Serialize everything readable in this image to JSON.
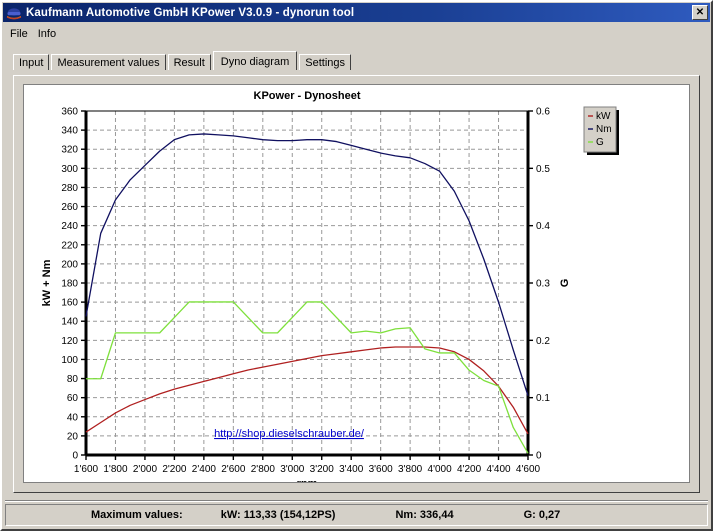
{
  "window": {
    "title": "Kaufmann Automotive GmbH  KPower V3.0.9 - dynorun tool",
    "close_label": "✕",
    "icon_name": "app-cap-icon"
  },
  "menu": {
    "items": [
      {
        "label": "File"
      },
      {
        "label": "Info"
      }
    ]
  },
  "tabs": [
    {
      "label": "Input",
      "active": false
    },
    {
      "label": "Measurement values",
      "active": false
    },
    {
      "label": "Result",
      "active": false
    },
    {
      "label": "Dyno diagram",
      "active": true
    },
    {
      "label": "Settings",
      "active": false
    }
  ],
  "statusbar": {
    "maximum_label": "Maximum values:",
    "kw": "kW: 113,33 (154,12PS)",
    "nm": "Nm: 336,44",
    "g": "G: 0,27"
  },
  "link": {
    "text": "http://shop.dieselschrauber.de/",
    "color": "#0000cc"
  },
  "colors": {
    "kw": "#b02020",
    "nm": "#101060",
    "g": "#7ee03c",
    "grid": "#999999",
    "axis": "#000000",
    "plot_bg": "#ffffff",
    "window_bg": "#d4d0c8",
    "titlebar": "#0a246a"
  },
  "chart_data": {
    "type": "line",
    "title": "KPower - Dynosheet",
    "xlabel": "rpm",
    "ylabel": "kW + Nm",
    "y2label": "G",
    "grid": true,
    "legend_position": "right-outside-top",
    "xlim": [
      1600,
      4600
    ],
    "xticks": [
      1600,
      1800,
      2000,
      2200,
      2400,
      2600,
      2800,
      3000,
      3200,
      3400,
      3600,
      3800,
      4000,
      4200,
      4400,
      4600
    ],
    "xticklabels": [
      "1'600",
      "1'800",
      "2'000",
      "2'200",
      "2'400",
      "2'600",
      "2'800",
      "3'000",
      "3'200",
      "3'400",
      "3'600",
      "3'800",
      "4'000",
      "4'200",
      "4'400",
      "4'600"
    ],
    "ylim": [
      0,
      360
    ],
    "yticks": [
      0,
      20,
      40,
      60,
      80,
      100,
      120,
      140,
      160,
      180,
      200,
      220,
      240,
      260,
      280,
      300,
      320,
      340,
      360
    ],
    "yticklabels": [
      "0",
      "20",
      "40",
      "60",
      "80",
      "100",
      "120",
      "140",
      "160",
      "180",
      "200",
      "220",
      "240",
      "260",
      "280",
      "300",
      "320",
      "340",
      "360"
    ],
    "y2lim": [
      0,
      0.6
    ],
    "y2ticks": [
      0,
      0.1,
      0.2,
      0.3,
      0.4,
      0.5,
      0.6
    ],
    "y2ticklabels": [
      "0",
      "0.1",
      "0.2",
      "0.3",
      "0.4",
      "0.5",
      "0.6"
    ],
    "legend": [
      {
        "name": "kW",
        "color": "#b02020"
      },
      {
        "name": "Nm",
        "color": "#101060"
      },
      {
        "name": "G",
        "color": "#7ee03c"
      }
    ],
    "x": [
      1600,
      1700,
      1800,
      1900,
      2000,
      2100,
      2200,
      2300,
      2400,
      2500,
      2600,
      2700,
      2800,
      2900,
      3000,
      3100,
      3200,
      3300,
      3400,
      3500,
      3600,
      3700,
      3800,
      3900,
      4000,
      4100,
      4200,
      4300,
      4400,
      4500,
      4600
    ],
    "series": [
      {
        "name": "Nm",
        "axis": "left",
        "color": "#101060",
        "unit": "Nm",
        "values": [
          145,
          232,
          267,
          288,
          303,
          318,
          330,
          335,
          336,
          335,
          334,
          332,
          330,
          329,
          329,
          330,
          330,
          328,
          324,
          320,
          316,
          313,
          311,
          305,
          297,
          276,
          245,
          205,
          160,
          110,
          62
        ]
      },
      {
        "name": "kW",
        "axis": "left",
        "color": "#b02020",
        "unit": "kW",
        "values": [
          24,
          34,
          44,
          52,
          58,
          64,
          69,
          73,
          77,
          81,
          85,
          89,
          92,
          95,
          98,
          101,
          104,
          106,
          108,
          110,
          112,
          113,
          113,
          113,
          112,
          108,
          100,
          88,
          72,
          50,
          22
        ]
      },
      {
        "name": "G",
        "axis": "right",
        "color": "#7ee03c",
        "unit": "G",
        "note": "plotted on right axis (0 - 0.6); stepped trace",
        "values": [
          0.133,
          0.133,
          0.213,
          0.213,
          0.213,
          0.213,
          0.24,
          0.267,
          0.267,
          0.267,
          0.267,
          0.24,
          0.213,
          0.213,
          0.24,
          0.267,
          0.267,
          0.24,
          0.213,
          0.216,
          0.213,
          0.22,
          0.222,
          0.185,
          0.178,
          0.178,
          0.148,
          0.13,
          0.12,
          0.048,
          0.003
        ]
      }
    ]
  }
}
